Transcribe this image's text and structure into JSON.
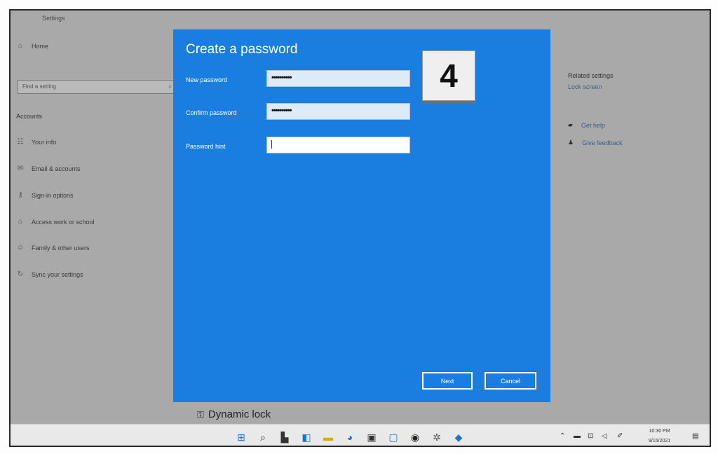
{
  "window": {
    "title": "Settings"
  },
  "sidebar": {
    "home": "Home",
    "find_placeholder": "Find a setting",
    "section": "Accounts",
    "items": [
      {
        "label": "Your info",
        "icon": "person-card-icon"
      },
      {
        "label": "Email & accounts",
        "icon": "email-icon"
      },
      {
        "label": "Sign-in options",
        "icon": "key-icon"
      },
      {
        "label": "Access work or school",
        "icon": "briefcase-icon"
      },
      {
        "label": "Family & other users",
        "icon": "people-icon"
      },
      {
        "label": "Sync your settings",
        "icon": "sync-icon"
      }
    ]
  },
  "right": {
    "related_title": "Related settings",
    "lock_screen": "Lock screen",
    "get_help": "Get help",
    "give_feedback": "Give feedback"
  },
  "main": {
    "dynamic_lock": "Dynamic lock"
  },
  "dialog": {
    "title": "Create a password",
    "new_password_label": "New password",
    "new_password_value": "••••••••••",
    "confirm_password_label": "Confirm password",
    "confirm_password_value": "••••••••••",
    "hint_label": "Password hint",
    "hint_value": "",
    "step_badge": "4",
    "next_label": "Next",
    "cancel_label": "Cancel",
    "accent": "#1a7ee0"
  },
  "taskbar": {
    "time": "10:30 PM",
    "date": "9/15/2021"
  }
}
